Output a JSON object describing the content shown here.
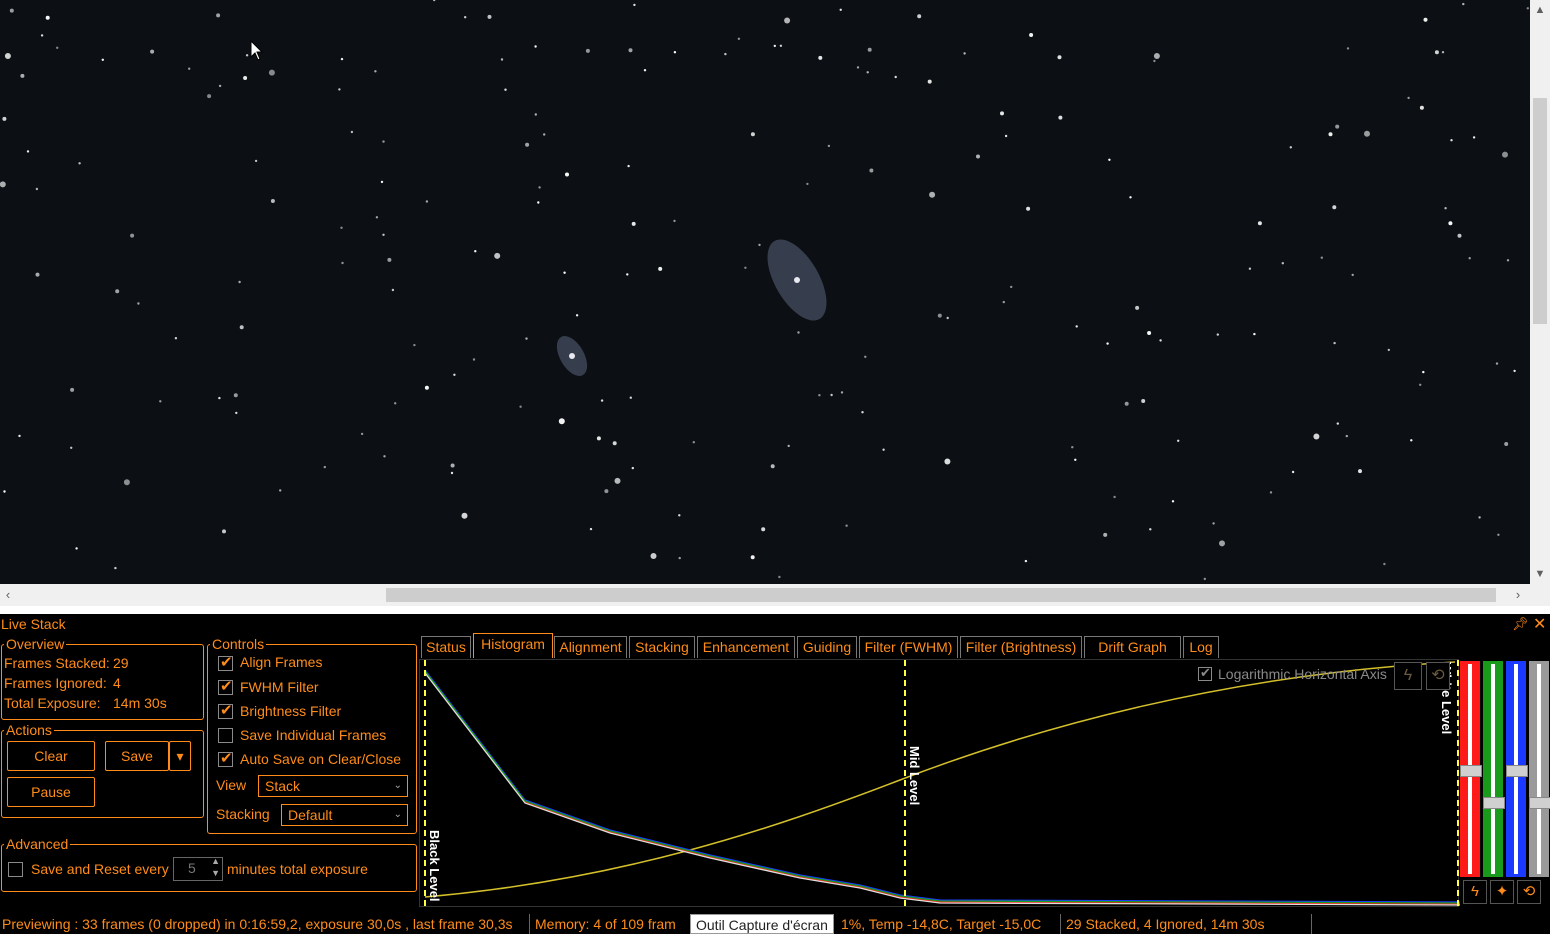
{
  "viewer": {
    "background": "#0c0f14",
    "star_color": "#ffffff"
  },
  "panel": {
    "title": "Live Stack",
    "pin_icon": "pin-icon",
    "close_icon": "close-icon"
  },
  "overview": {
    "legend": "Overview",
    "frames_stacked_label": "Frames Stacked:",
    "frames_stacked": "29",
    "frames_ignored_label": "Frames Ignored:",
    "frames_ignored": "4",
    "total_exposure_label": "Total Exposure:",
    "total_exposure": "14m 30s"
  },
  "actions": {
    "legend": "Actions",
    "clear": "Clear",
    "save": "Save",
    "save_dropdown": "▾",
    "pause": "Pause"
  },
  "controls": {
    "legend": "Controls",
    "align_frames": "Align Frames",
    "fwhm_filter": "FWHM Filter",
    "brightness_filter": "Brightness Filter",
    "save_individual": "Save Individual Frames",
    "auto_save": "Auto Save on Clear/Close",
    "view_label": "View",
    "view_value": "Stack",
    "stacking_label": "Stacking",
    "stacking_value": "Default"
  },
  "advanced": {
    "legend": "Advanced",
    "save_reset_label": "Save and Reset every",
    "minutes_value": "5",
    "minutes_suffix": "minutes total exposure"
  },
  "tabs": [
    {
      "label": "Status"
    },
    {
      "label": "Histogram"
    },
    {
      "label": "Alignment"
    },
    {
      "label": "Stacking"
    },
    {
      "label": "Enhancement"
    },
    {
      "label": "Guiding"
    },
    {
      "label": "Filter (FWHM)"
    },
    {
      "label": "Filter (Brightness)"
    },
    {
      "label": "Drift Graph"
    },
    {
      "label": "Log"
    }
  ],
  "active_tab": "Histogram",
  "histogram": {
    "log_axis_label": "Logarithmic Horizontal Axis",
    "log_axis_checked": true,
    "black_level_label": "Black Level",
    "mid_level_label": "Mid Level",
    "white_level_label": "White Level",
    "curve_color": "#d4c02a",
    "marker_color": "#ffff40"
  },
  "statusbar": {
    "previewing": "Previewing : 33 frames (0 dropped) in 0:16:59,2, exposure 30,0s , last frame 30,3s",
    "memory": "Memory: 4 of 109 fram",
    "temp": "1%, Temp -14,8C, Target -15,0C",
    "stack_summary": "29 Stacked, 4 Ignored, 14m 30s",
    "tooltip": "Outil Capture d'écran"
  },
  "colors": {
    "accent": "#ff8c1a",
    "red": "#ff1a1a",
    "green": "#1a9a1a",
    "blue": "#1a3aff",
    "grey": "#9a9a9a"
  }
}
